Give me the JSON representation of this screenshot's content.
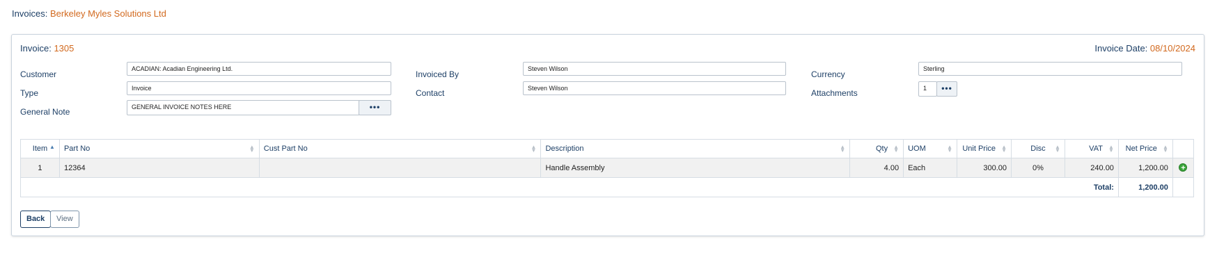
{
  "page": {
    "title_prefix": "Invoices:",
    "company": "Berkeley Myles Solutions Ltd"
  },
  "invoice": {
    "number_label": "Invoice:",
    "number": "1305",
    "date_label": "Invoice Date:",
    "date": "08/10/2024"
  },
  "fields": {
    "customer_label": "Customer",
    "customer_value": "ACADIAN: Acadian Engineering Ltd.",
    "type_label": "Type",
    "type_value": "Invoice",
    "general_note_label": "General Note",
    "general_note_value": "GENERAL INVOICE NOTES HERE",
    "invoiced_by_label": "Invoiced By",
    "invoiced_by_value": "Steven Wilson",
    "contact_label": "Contact",
    "contact_value": "Steven Wilson",
    "currency_label": "Currency",
    "currency_value": "Sterling",
    "attachments_label": "Attachments",
    "attachments_value": "1",
    "dots": "•••"
  },
  "table": {
    "headers": {
      "item": "Item",
      "part_no": "Part No",
      "cust_part_no": "Cust Part No",
      "description": "Description",
      "qty": "Qty",
      "uom": "UOM",
      "unit_price": "Unit Price",
      "disc": "Disc",
      "vat": "VAT",
      "net_price": "Net Price"
    },
    "rows": [
      {
        "item": "1",
        "part_no": "12364",
        "cust_part_no": "",
        "description": "Handle Assembly",
        "qty": "4.00",
        "uom": "Each",
        "unit_price": "300.00",
        "disc": "0%",
        "vat": "240.00",
        "net_price": "1,200.00"
      }
    ],
    "total_label": "Total:",
    "total_value": "1,200.00"
  },
  "buttons": {
    "back": "Back",
    "view": "View"
  },
  "icons": {
    "add": "add-circle-icon",
    "sort": "sort-arrows-icon"
  },
  "colors": {
    "accent": "#d2691e",
    "navy": "#1d3f66",
    "add_green": "#3aa43a"
  }
}
